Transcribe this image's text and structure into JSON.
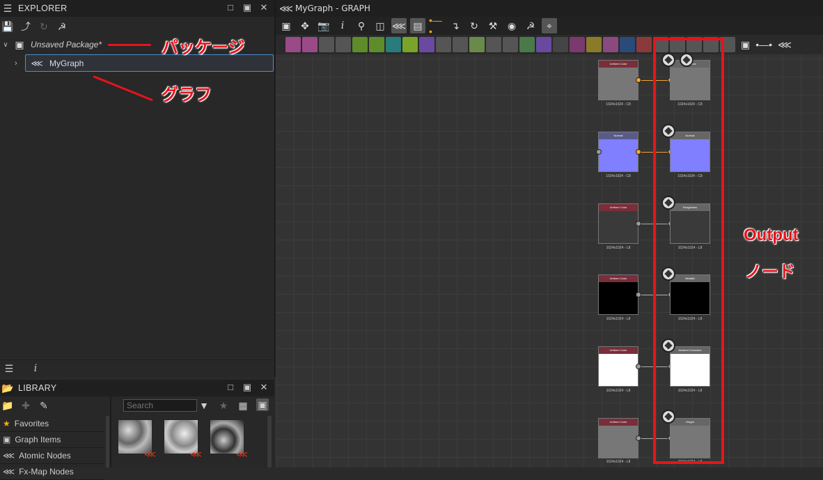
{
  "explorer": {
    "title": "EXPLORER",
    "package_label": "Unsaved Package*",
    "graph_label": "MyGraph"
  },
  "annotations": {
    "package": "パッケージ",
    "graph": "グラフ",
    "output_line1": "Output",
    "output_line2": "ノード"
  },
  "library": {
    "title": "LIBRARY",
    "search_placeholder": "Search",
    "items": [
      "Favorites",
      "Graph Items",
      "Atomic Nodes",
      "Fx-Map Nodes"
    ]
  },
  "graph": {
    "title": "MyGraph - GRAPH"
  },
  "nodes": {
    "uniform_color": "Uniform Color",
    "normal": "Normal",
    "roughness": "Roughness",
    "metallic": "Metallic",
    "ambient_occlusion": "Ambient Occlusion",
    "height": "Height",
    "basecolor": "Basecolor",
    "res_c8": "1024x1024 - C8",
    "res_l8": "1024x1024 - L8"
  },
  "colors": {
    "accent_red": "#e8131a",
    "selection_blue": "#4a8fd0",
    "port_orange": "#f3a42a",
    "normal_purple": "#7f7fff"
  }
}
